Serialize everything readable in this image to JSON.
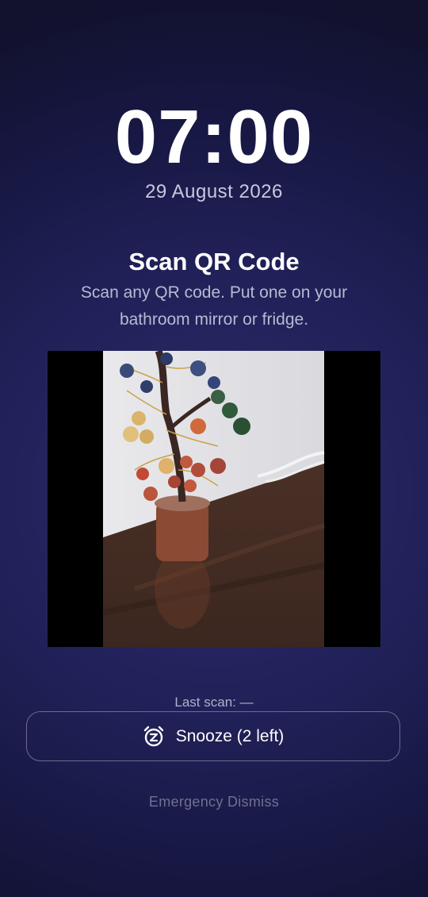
{
  "alarm": {
    "time": "07:00",
    "date": "29 August 2026"
  },
  "challenge": {
    "title": "Scan QR Code",
    "description": "Scan any QR code. Put one on your bathroom mirror or fridge."
  },
  "camera_preview": {
    "content": "live camera feed showing a gemstone tree ornament on a wooden table"
  },
  "status": {
    "last_scan": "Last scan: —"
  },
  "actions": {
    "snooze_label": "Snooze (2 left)",
    "snooze_icon": "alarm-snooze-icon",
    "emergency_dismiss_label": "Emergency Dismiss"
  },
  "colors": {
    "background": "#212159",
    "accent_text": "#ffffff",
    "muted_text": "#6f7191"
  }
}
